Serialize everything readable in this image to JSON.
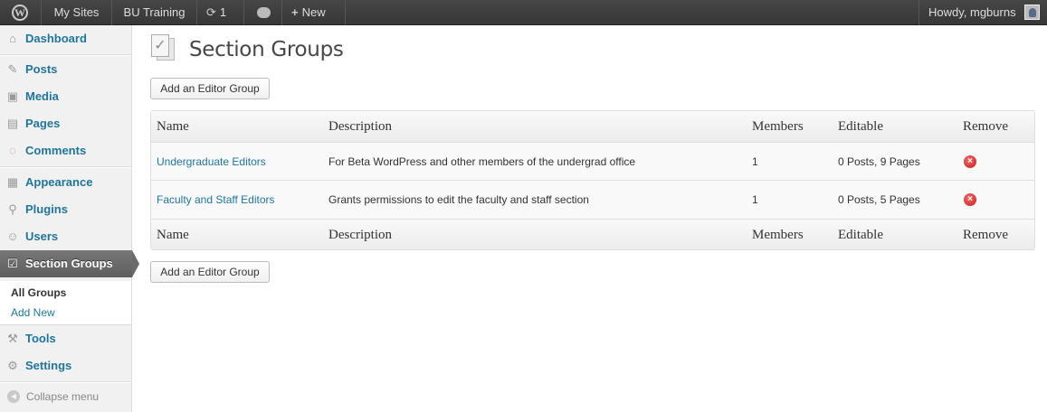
{
  "adminbar": {
    "logo": "wordpress-logo",
    "my_sites": "My Sites",
    "site_name": "BU Training",
    "updates_count": "1",
    "new_label": "New",
    "account": "Howdy, mgburns"
  },
  "sidebar": {
    "items": {
      "dashboard": "Dashboard",
      "posts": "Posts",
      "media": "Media",
      "pages": "Pages",
      "comments": "Comments",
      "appearance": "Appearance",
      "plugins": "Plugins",
      "users": "Users",
      "section_groups": "Section Groups",
      "tools": "Tools",
      "settings": "Settings"
    },
    "submenu": {
      "all_groups": "All Groups",
      "add_new": "Add New"
    },
    "collapse": "Collapse menu"
  },
  "main": {
    "title": "Section Groups",
    "add_button": "Add an Editor Group",
    "columns": {
      "name": "Name",
      "description": "Description",
      "members": "Members",
      "editable": "Editable",
      "remove": "Remove"
    },
    "rows": [
      {
        "name": "Undergraduate Editors",
        "description": "For Beta WordPress and other members of the undergrad office",
        "members": "1",
        "editable": "0 Posts, 9 Pages"
      },
      {
        "name": "Faculty and Staff Editors",
        "description": "Grants permissions to edit the faculty and staff section",
        "members": "1",
        "editable": "0 Posts, 5 Pages"
      }
    ]
  },
  "colors": {
    "link": "#21759b",
    "adminbar": "#464646",
    "current_menu": "#6b6b6b",
    "remove": "#d02525"
  }
}
